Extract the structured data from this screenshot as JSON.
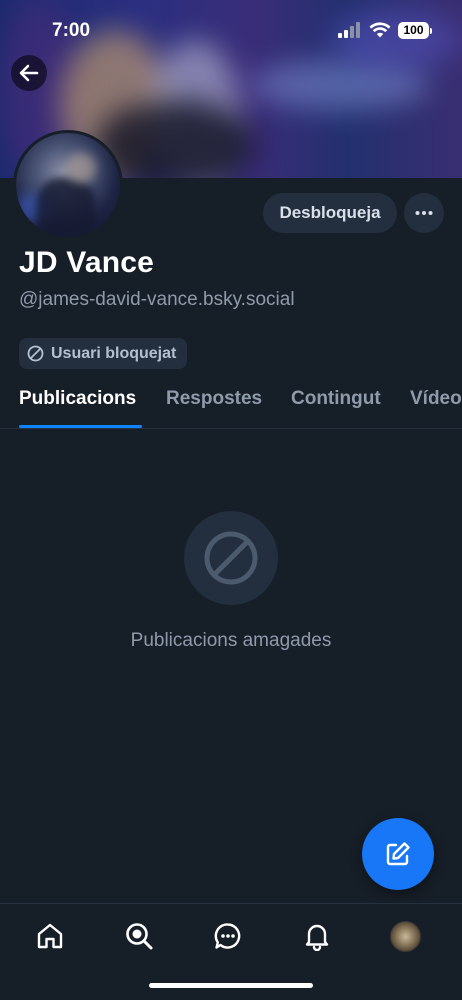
{
  "status_bar": {
    "time": "7:00",
    "battery": "100"
  },
  "profile": {
    "display_name": "JD Vance",
    "handle": "@james-david-vance.bsky.social",
    "unblock_label": "Desbloqueja",
    "blocked_badge": "Usuari bloquejat"
  },
  "tabs": [
    {
      "label": "Publicacions",
      "active": true
    },
    {
      "label": "Respostes",
      "active": false
    },
    {
      "label": "Contingut",
      "active": false
    },
    {
      "label": "Vídeo",
      "active": false
    }
  ],
  "empty_state": {
    "icon": "blocked-icon",
    "message": "Publicacions amagades"
  },
  "bottom_nav": {
    "items": [
      "home-icon",
      "search-icon",
      "chat-icon",
      "bell-icon",
      "profile-avatar"
    ]
  },
  "colors": {
    "background": "#161e27",
    "accent": "#1083fe",
    "fab": "#1777f6",
    "muted_text": "#8f9bab",
    "pill_bg": "#232e3e"
  }
}
